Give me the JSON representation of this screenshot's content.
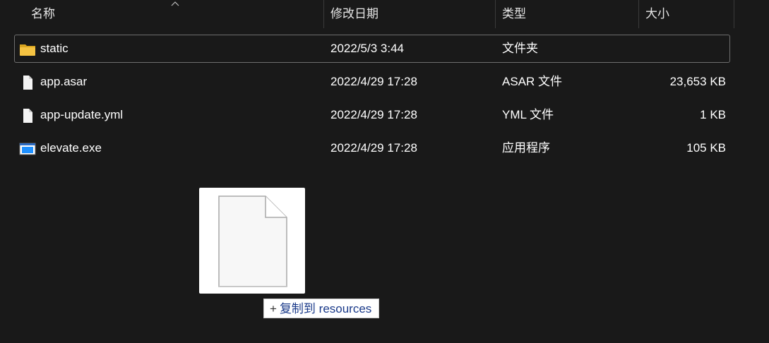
{
  "columns": {
    "name": "名称",
    "date": "修改日期",
    "type": "类型",
    "size": "大小"
  },
  "files": [
    {
      "name": "static",
      "date": "2022/5/3 3:44",
      "type": "文件夹",
      "size": "",
      "icon": "folder-icon",
      "selected": true
    },
    {
      "name": "app.asar",
      "date": "2022/4/29 17:28",
      "type": "ASAR 文件",
      "size": "23,653 KB",
      "icon": "file-icon",
      "selected": false
    },
    {
      "name": "app-update.yml",
      "date": "2022/4/29 17:28",
      "type": "YML 文件",
      "size": "1 KB",
      "icon": "file-icon",
      "selected": false
    },
    {
      "name": "elevate.exe",
      "date": "2022/4/29 17:28",
      "type": "应用程序",
      "size": "105 KB",
      "icon": "exe-icon",
      "selected": false
    }
  ],
  "drag": {
    "tooltip_plus": "+",
    "tooltip_text": "复制到 resources"
  },
  "colors": {
    "background": "#191919",
    "folder": "#f0c040",
    "exe_accent": "#1e90ff",
    "tooltip_text": "#1a3a8a"
  }
}
